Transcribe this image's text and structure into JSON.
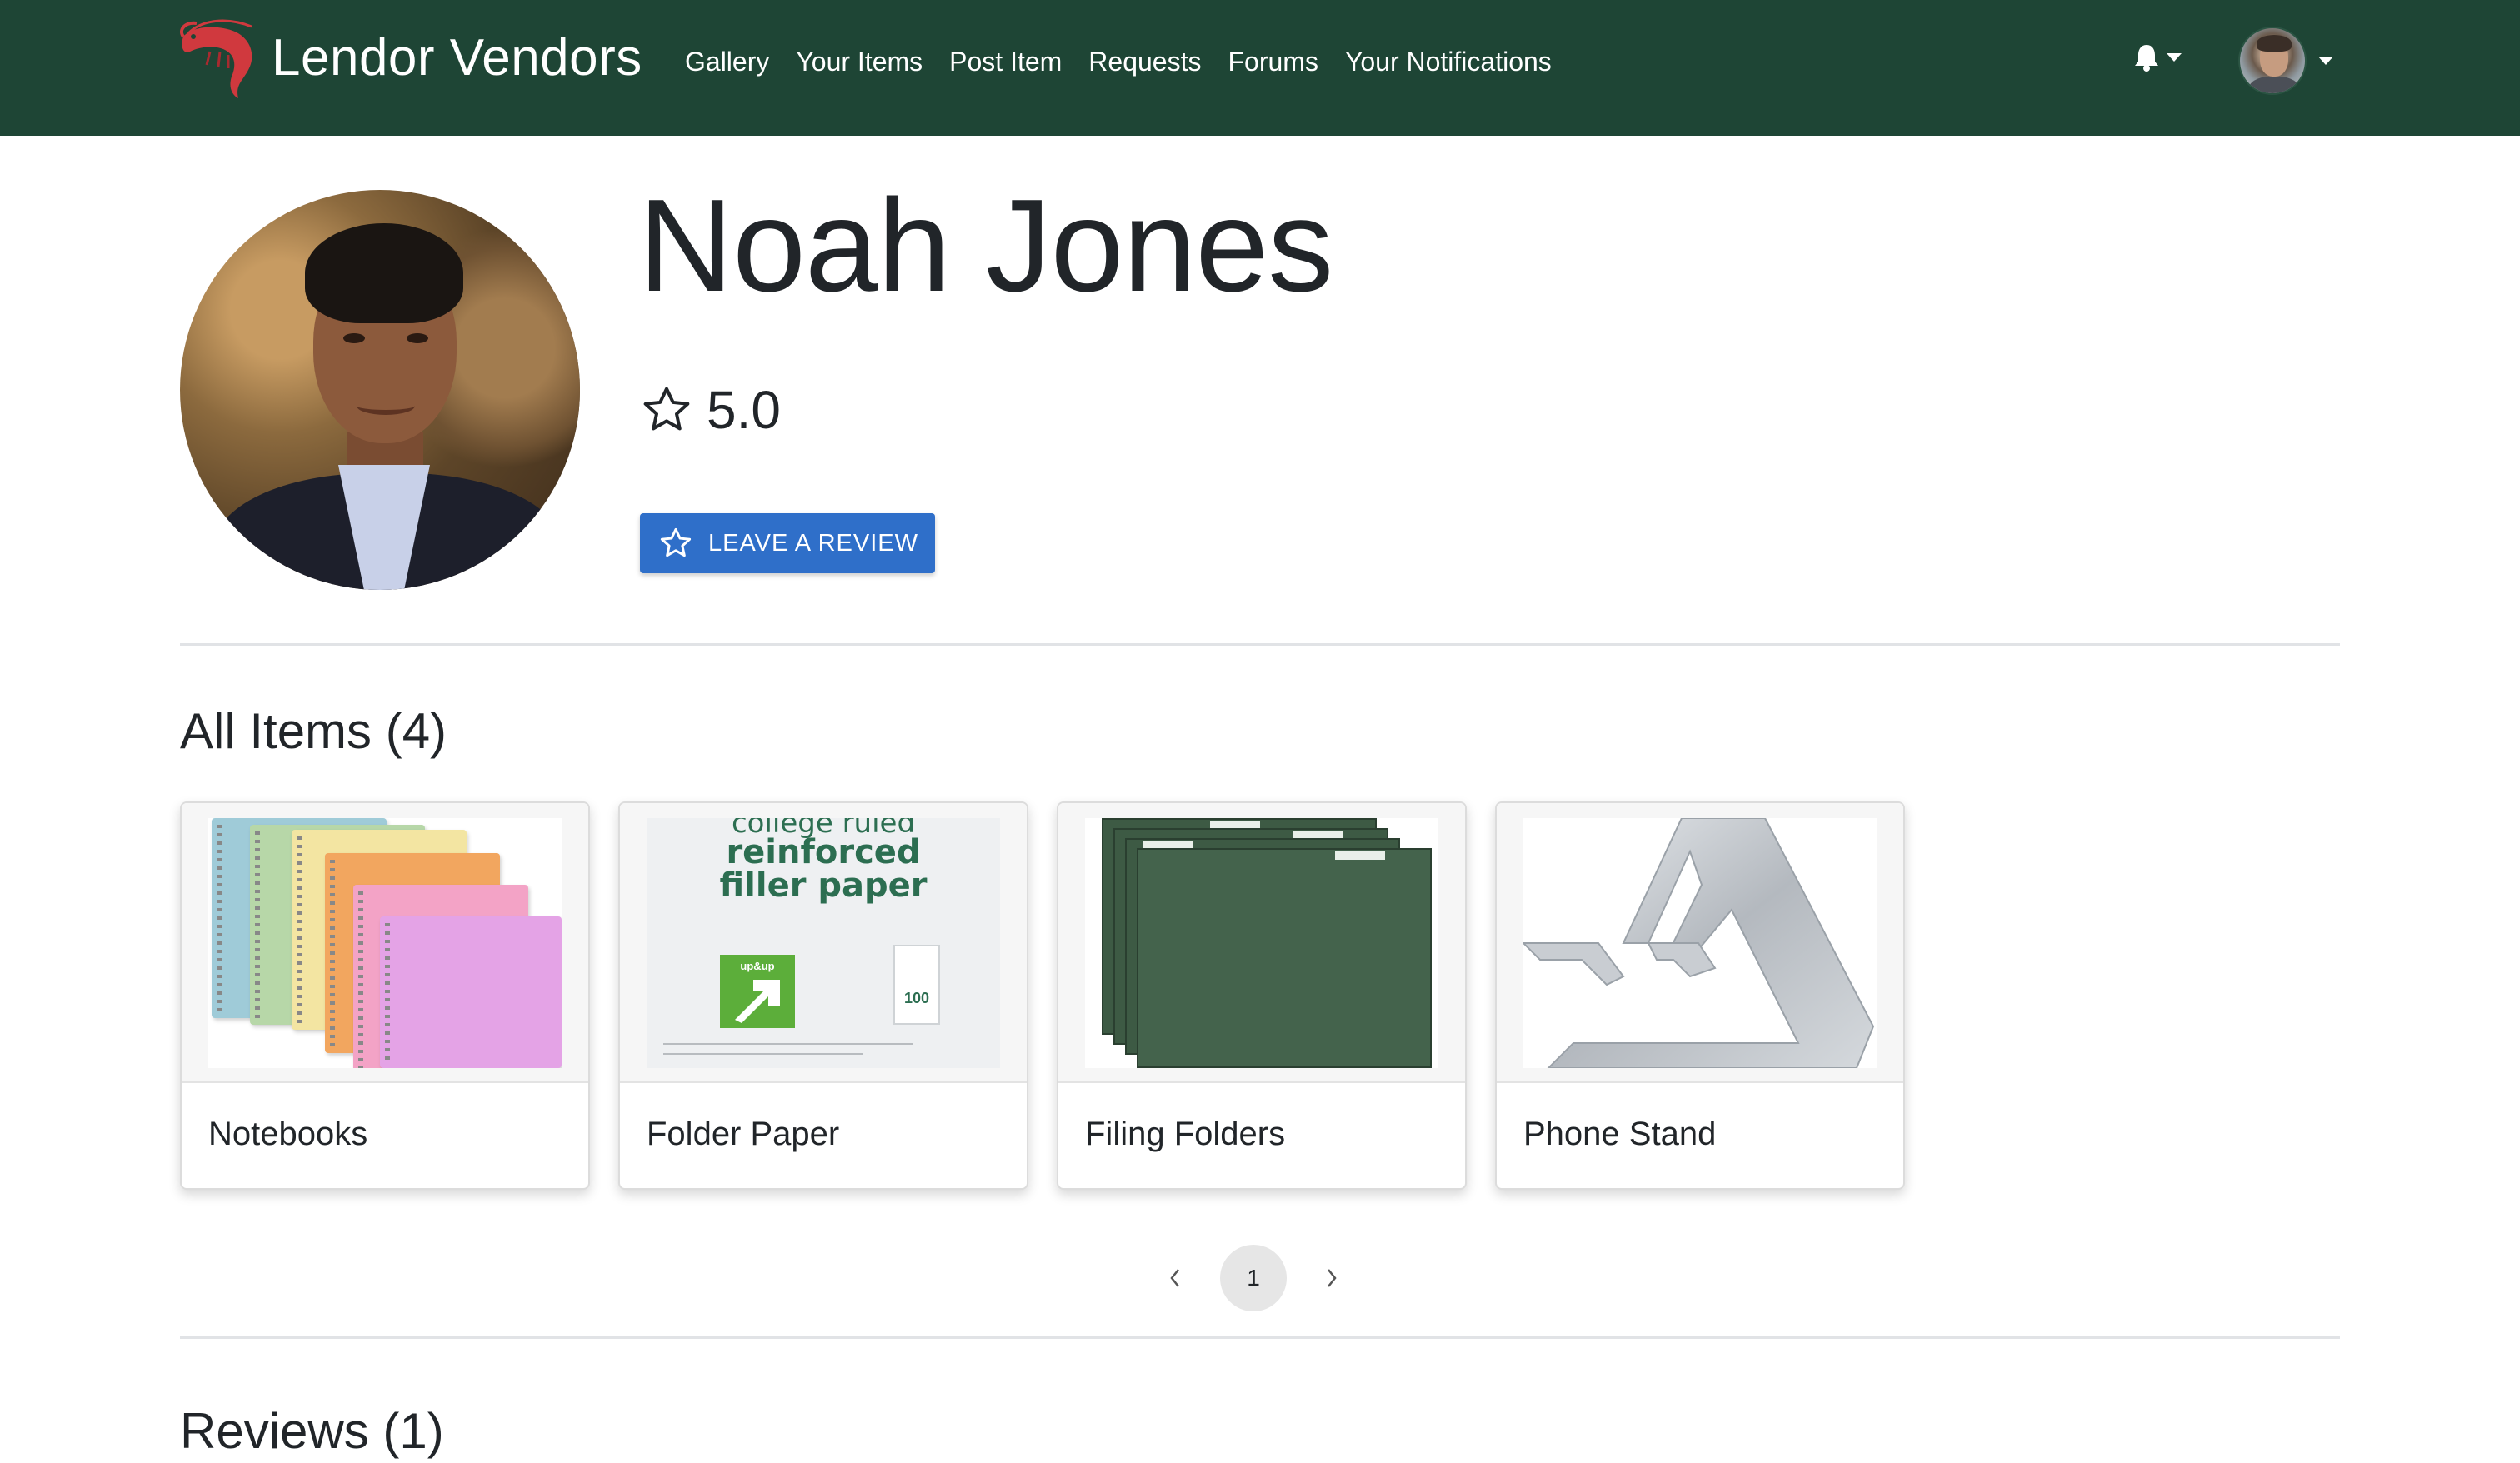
{
  "navbar": {
    "brand": "Lendor Vendors",
    "links": [
      {
        "label": "Gallery"
      },
      {
        "label": "Your Items"
      },
      {
        "label": "Post Item"
      },
      {
        "label": "Requests"
      },
      {
        "label": "Forums"
      },
      {
        "label": "Your Notifications"
      }
    ],
    "icons": [
      "shrimp-logo-icon",
      "bell-icon",
      "caret-down-icon",
      "user-avatar"
    ]
  },
  "profile": {
    "name": "Noah Jones",
    "rating": "5.0",
    "review_button_label": "LEAVE A REVIEW"
  },
  "items": {
    "title": "All Items (4)",
    "cards": [
      {
        "title": "Notebooks"
      },
      {
        "title": "Folder Paper",
        "image_text": {
          "line1": "college ruled",
          "line2": "reinforced",
          "line3": "filler paper",
          "brand": "up&up",
          "count": "100"
        }
      },
      {
        "title": "Filing Folders"
      },
      {
        "title": "Phone Stand"
      }
    ]
  },
  "pagination": {
    "current_page": "1"
  },
  "reviews": {
    "title": "Reviews (1)"
  },
  "colors": {
    "navbar": "#1e4535",
    "button": "#2f6fc9",
    "logo": "#d0393e"
  }
}
